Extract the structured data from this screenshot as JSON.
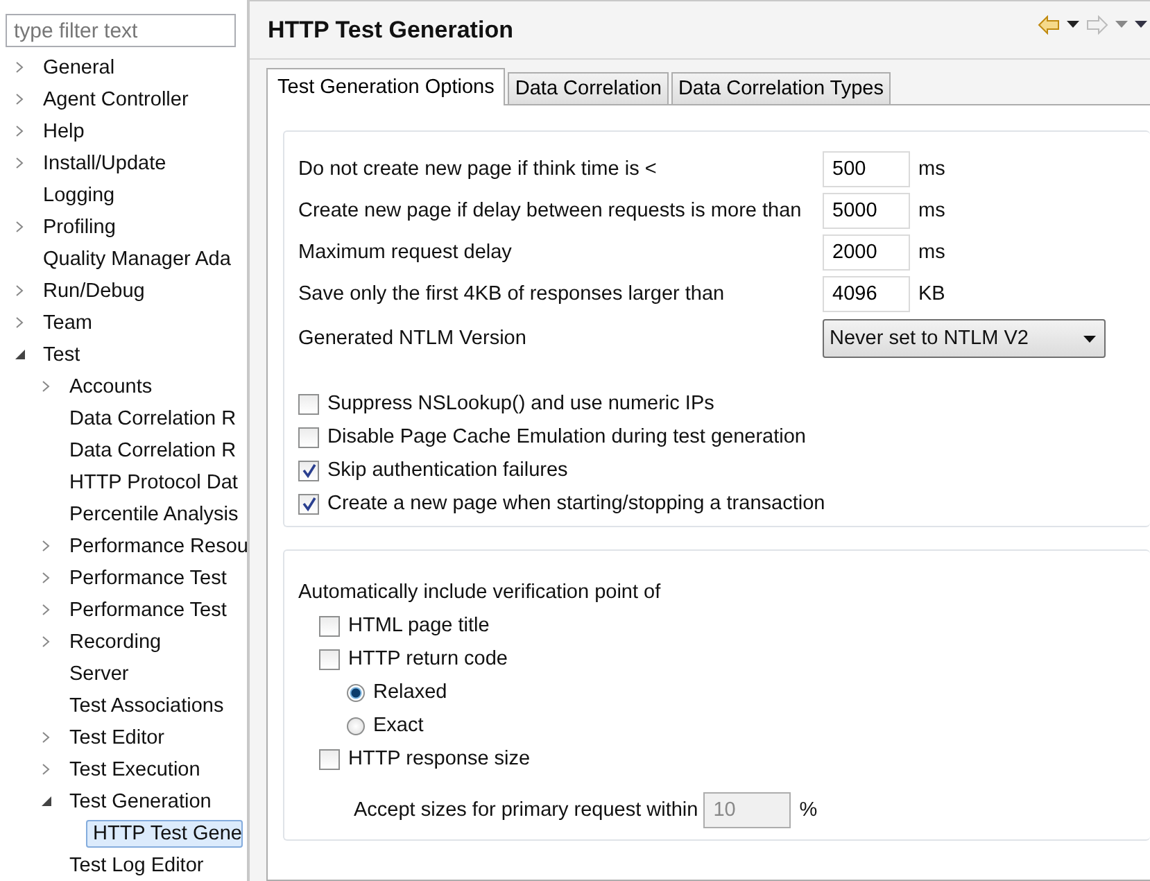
{
  "filter": {
    "placeholder": "type filter text"
  },
  "tree": [
    {
      "label": "General",
      "expanded": false,
      "selected": false
    },
    {
      "label": "Agent Controller",
      "expanded": false,
      "selected": false
    },
    {
      "label": "Help",
      "expanded": false,
      "selected": false
    },
    {
      "label": "Install/Update",
      "expanded": false,
      "selected": false
    },
    {
      "label": "Logging",
      "selected": false
    },
    {
      "label": "Profiling",
      "expanded": false,
      "selected": false
    },
    {
      "label": "Quality Manager Ada",
      "selected": false
    },
    {
      "label": "Run/Debug",
      "expanded": false,
      "selected": false
    },
    {
      "label": "Team",
      "expanded": false,
      "selected": false
    },
    {
      "label": "Test",
      "expanded": true,
      "selected": false,
      "children": [
        {
          "label": "Accounts",
          "expanded": false,
          "selected": false
        },
        {
          "label": "Data Correlation R",
          "selected": false
        },
        {
          "label": "Data Correlation R",
          "selected": false
        },
        {
          "label": "HTTP Protocol Dat",
          "selected": false
        },
        {
          "label": "Percentile Analysis",
          "selected": false
        },
        {
          "label": "Performance Resou",
          "expanded": false,
          "selected": false
        },
        {
          "label": "Performance Test",
          "expanded": false,
          "selected": false
        },
        {
          "label": "Performance Test",
          "expanded": false,
          "selected": false
        },
        {
          "label": "Recording",
          "expanded": false,
          "selected": false
        },
        {
          "label": "Server",
          "selected": false
        },
        {
          "label": "Test Associations",
          "selected": false
        },
        {
          "label": "Test Editor",
          "expanded": false,
          "selected": false
        },
        {
          "label": "Test Execution",
          "expanded": false,
          "selected": false
        },
        {
          "label": "Test Generation",
          "expanded": true,
          "selected": false,
          "children": [
            {
              "label": "HTTP Test Gene",
              "selected": true
            }
          ]
        },
        {
          "label": "Test Log Editor",
          "selected": false
        }
      ]
    }
  ],
  "page": {
    "title": "HTTP Test Generation"
  },
  "tabs": [
    {
      "label": "Test Generation Options",
      "selected": true
    },
    {
      "label": "Data Correlation",
      "selected": false
    },
    {
      "label": "Data Correlation Types",
      "selected": false
    }
  ],
  "fields": [
    {
      "label": "Do not create new page if think time is <",
      "value": "500",
      "unit": "ms"
    },
    {
      "label": "Create new page if delay between requests is more than",
      "value": "5000",
      "unit": "ms"
    },
    {
      "label": "Maximum request delay",
      "value": "2000",
      "unit": "ms"
    },
    {
      "label": "Save only the first 4KB of responses larger than",
      "value": "4096",
      "unit": "KB"
    }
  ],
  "ntlm": {
    "label": "Generated NTLM Version",
    "value": "Never set to NTLM V2"
  },
  "options": [
    {
      "label": "Suppress NSLookup() and use numeric IPs",
      "checked": false
    },
    {
      "label": "Disable Page Cache Emulation during test generation",
      "checked": false
    },
    {
      "label": "Skip authentication failures",
      "checked": true
    },
    {
      "label": "Create a new page when starting/stopping a transaction",
      "checked": true
    }
  ],
  "verification": {
    "heading": "Automatically include verification point of",
    "items": [
      {
        "kind": "checkbox",
        "label": "HTML page title",
        "checked": false
      },
      {
        "kind": "checkbox",
        "label": "HTTP return code",
        "checked": false
      },
      {
        "kind": "radio",
        "label": "Relaxed",
        "selected": true
      },
      {
        "kind": "radio",
        "label": "Exact",
        "selected": false
      },
      {
        "kind": "checkbox",
        "label": "HTTP response size",
        "checked": false
      }
    ],
    "tolerance": {
      "label": "Accept sizes for primary request within",
      "value": "10",
      "unit": "%",
      "disabled": true
    }
  }
}
